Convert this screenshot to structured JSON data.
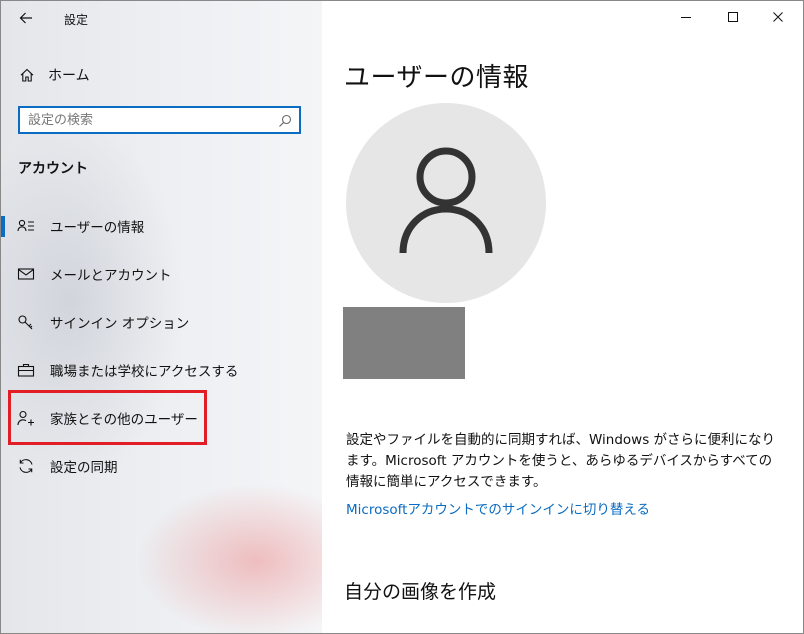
{
  "window": {
    "app_title": "設定",
    "controls": {
      "minimize": "minimize",
      "maximize": "maximize",
      "close": "close"
    }
  },
  "sidebar": {
    "home_label": "ホーム",
    "search_placeholder": "設定の検索",
    "section_title": "アカウント",
    "items": [
      {
        "label": "ユーザーの情報",
        "icon": "user-info-icon",
        "selected": true
      },
      {
        "label": "メールとアカウント",
        "icon": "mail-icon",
        "selected": false
      },
      {
        "label": "サインイン オプション",
        "icon": "key-icon",
        "selected": false
      },
      {
        "label": "職場または学校にアクセスする",
        "icon": "briefcase-icon",
        "selected": false
      },
      {
        "label": "家族とその他のユーザー",
        "icon": "add-user-icon",
        "selected": false,
        "highlighted": true
      },
      {
        "label": "設定の同期",
        "icon": "sync-icon",
        "selected": false
      }
    ]
  },
  "main": {
    "page_title": "ユーザーの情報",
    "description": "設定やファイルを自動的に同期すれば、Windows がさらに便利になります。Microsoft アカウントを使うと、あらゆるデバイスからすべての情報に簡単にアクセスできます。",
    "signin_link": "Microsoftアカウントでのサインインに切り替える",
    "create_picture_heading": "自分の画像を作成"
  },
  "colors": {
    "accent": "#0a6cc2",
    "highlight": "#e11d25",
    "redacted": "#808080",
    "avatar_bg": "#e6e6e6"
  }
}
